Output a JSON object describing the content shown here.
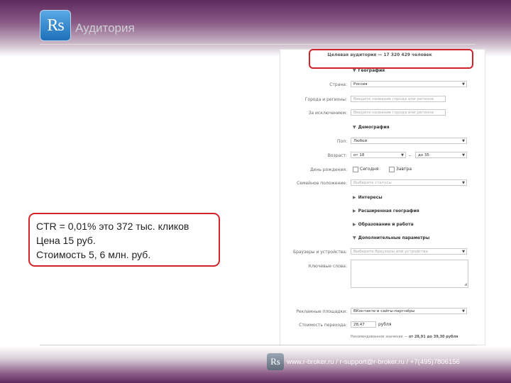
{
  "header": {
    "logo_text": "Rs",
    "title": "Аудитория"
  },
  "form": {
    "target_audience": "Целевая аудитория — 17 320 429 человек",
    "sections": {
      "geo": "География",
      "demo": "Демография",
      "interests": "Интересы",
      "ext_geo": "Расширенная география",
      "education": "Образование и работа",
      "extra": "Дополнительные параметры"
    },
    "labels": {
      "country": "Страна:",
      "cities": "Города и регионы:",
      "except": "За исключением:",
      "gender": "Пол:",
      "age": "Возраст:",
      "birthday": "День рождения:",
      "marital": "Семейное положение:",
      "browsers": "Браузеры и устройства:",
      "keywords": "Ключевые слова:",
      "ad_platforms": "Рекламные площадки:",
      "cost": "Стоимость перехода:"
    },
    "values": {
      "country": "Россия",
      "cities_placeholder": "Введите название города или региона",
      "except_placeholder": "Введите название города или региона",
      "gender": "Любой",
      "age_from": "от 18",
      "age_sep": "–",
      "age_to": "до 35",
      "birthday_today": "Сегодня",
      "birthday_tomorrow": "Завтра",
      "marital_placeholder": "Выберите статусы",
      "browsers_placeholder": "Выберите браузеры или устройства",
      "ad_platforms": "ВКонтакте и сайты-партнёры",
      "cost": "28,47",
      "cost_unit": "рубля",
      "recommended_prefix": "Рекомендованное значение — ",
      "recommended_range": "от 28,91 до 39,30 рубля"
    },
    "icons": {
      "dropdown": "chevron-down-icon",
      "collapsed": "triangle-right-icon",
      "expanded": "triangle-down-icon"
    }
  },
  "callout": {
    "line1": "CTR = 0,01%  это 372 тыс. кликов",
    "line2": "Цена 15 руб.",
    "line3": "Стоимость 5, 6 млн. руб."
  },
  "footer": {
    "logo_text": "Rs",
    "contacts": "www.r-broker.ru / r-support@r-broker.ru / +7(495)7806156"
  },
  "colors": {
    "accent_red": "#d2232a",
    "brand_purple": "#5e2a5e",
    "logo_blue": "#1d70b8"
  }
}
